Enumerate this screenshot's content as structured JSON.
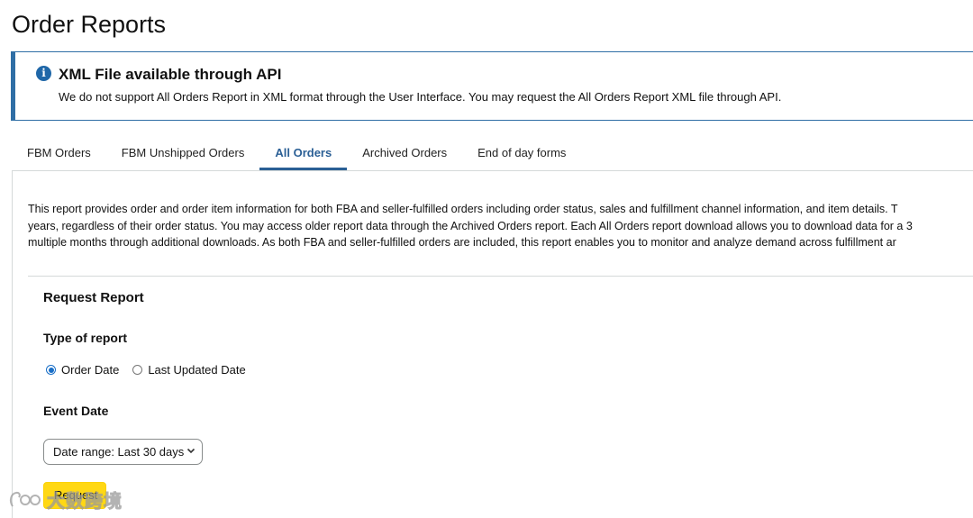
{
  "page": {
    "title": "Order Reports"
  },
  "alert": {
    "icon": "info-icon",
    "title": "XML File available through API",
    "text": "We do not support All Orders Report in XML format through the User Interface. You may request the All Orders Report XML file through API."
  },
  "tabs": [
    {
      "label": "FBM Orders",
      "active": false
    },
    {
      "label": "FBM Unshipped Orders",
      "active": false
    },
    {
      "label": "All Orders",
      "active": true
    },
    {
      "label": "Archived Orders",
      "active": false
    },
    {
      "label": "End of day forms",
      "active": false
    }
  ],
  "description": {
    "lines": [
      "This report provides order and order item information for both FBA and seller-fulfilled orders including order status, sales and fulfillment channel information, and item details. T",
      "years, regardless of their order status. You may access older report data through the Archived Orders report. Each All Orders report download allows you to download data for a 3",
      "multiple months through additional downloads. As both FBA and seller-fulfilled orders are included, this report enables you to monitor and analyze demand across fulfillment ar"
    ]
  },
  "request_report": {
    "title": "Request Report",
    "type_label": "Type of report",
    "options": [
      {
        "label": "Order Date",
        "checked": true
      },
      {
        "label": "Last Updated Date",
        "checked": false
      }
    ],
    "event_date_label": "Event Date",
    "date_range_value": "Date range: Last 30 days",
    "request_button": "Request"
  },
  "watermark": {
    "text": "大数跨境"
  },
  "colors": {
    "accent": "#2a5f95",
    "alert_border": "#2f6ea5",
    "button": "#ffd814"
  }
}
